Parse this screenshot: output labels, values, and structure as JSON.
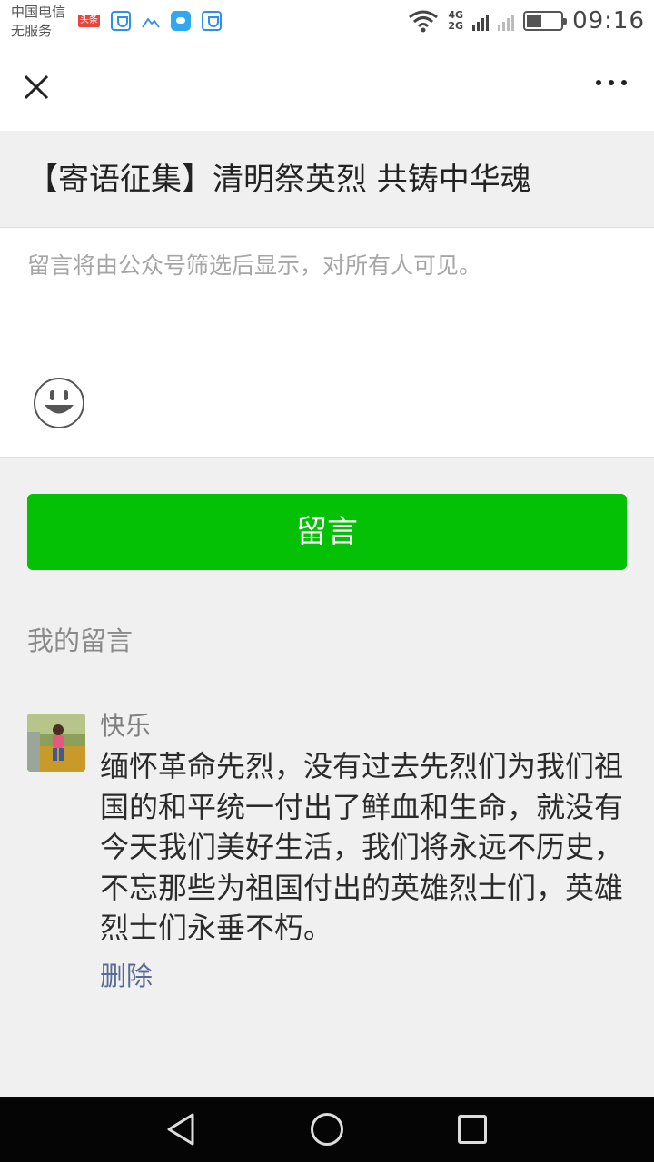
{
  "status_bar": {
    "carrier_line1": "中国电信",
    "carrier_line2": "无服务",
    "notif_toutiao": "头条",
    "network_4g": "4G",
    "network_2g": "2G",
    "time": "09:16",
    "icons": [
      "toutiao-icon",
      "shield-icon",
      "mountain-icon",
      "message-bubble-icon",
      "shield-icon",
      "wifi-icon",
      "signal-icon",
      "no-signal-icon",
      "battery-icon"
    ],
    "battery_level": 0.4
  },
  "toolbar": {
    "close_icon": "close-icon",
    "more_icon": "more-icon"
  },
  "article": {
    "title": "【寄语征集】清明祭英烈 共铸中华魂"
  },
  "comment_input": {
    "placeholder": "留言将由公众号筛选后显示，对所有人可见。",
    "emoji_icon": "smiley-icon"
  },
  "submit": {
    "label": "留言",
    "color": "#05c106"
  },
  "my_comments": {
    "section_label": "我的留言",
    "items": [
      {
        "nickname": "快乐",
        "text": "缅怀革命先烈，没有过去先烈们为我们祖国的和平统一付出了鲜血和生命，就没有今天我们美好生活，我们将永远不历史，不忘那些为祖国付出的英雄烈士们，英雄烈士们永垂不朽。",
        "delete_label": "删除"
      }
    ]
  },
  "nav_bar": {
    "buttons": [
      "back-icon",
      "home-icon",
      "recent-apps-icon"
    ]
  }
}
